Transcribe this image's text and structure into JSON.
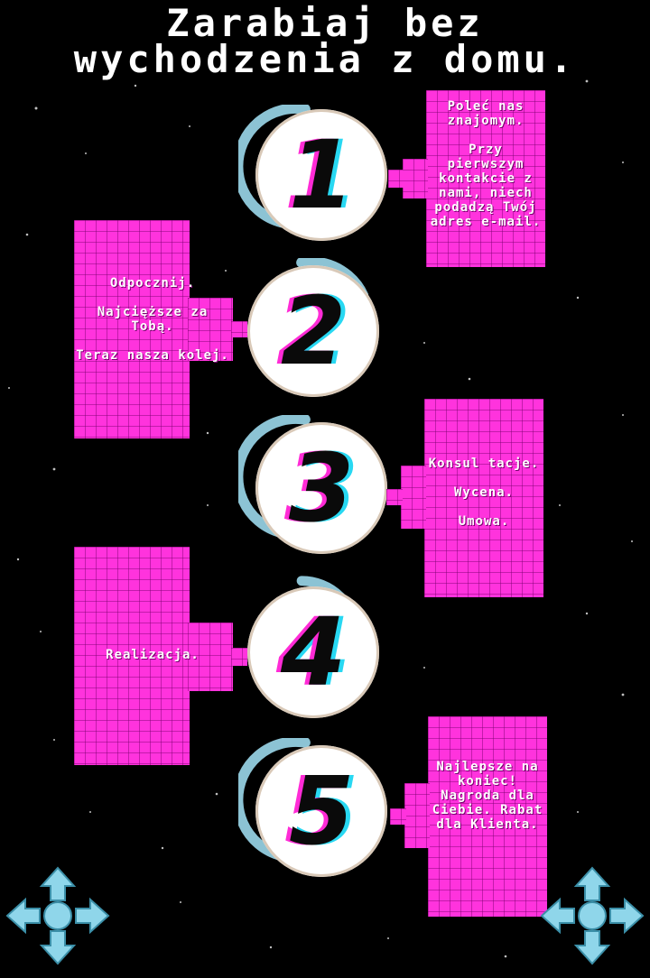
{
  "title": "Zarabiaj bez\nwychodzenia z domu.",
  "colors": {
    "background": "#000000",
    "box": "#ff33dd",
    "ring": "#8cc3d4",
    "glitch_pink": "#ff2bd6",
    "glitch_cyan": "#28d8f2"
  },
  "steps": [
    {
      "number": "1",
      "text": "Poleć nas znajomym.\n\nPrzy pierwszym kontakcie z nami, niech podadzą Twój adres e-mail."
    },
    {
      "number": "2",
      "text": "Odpocznij.\n\nNajcięższe za Tobą.\n\nTeraz nasza kolej."
    },
    {
      "number": "3",
      "text": "Konsul tacje.\n\nWycena.\n\nUmowa."
    },
    {
      "number": "4",
      "text": "Realizacja."
    },
    {
      "number": "5",
      "text": "Najlepsze na koniec! Nagroda dla Ciebie. Rabat dla Klienta."
    }
  ],
  "icons": {
    "left": "dpad-controller-icon",
    "right": "dpad-controller-icon"
  }
}
